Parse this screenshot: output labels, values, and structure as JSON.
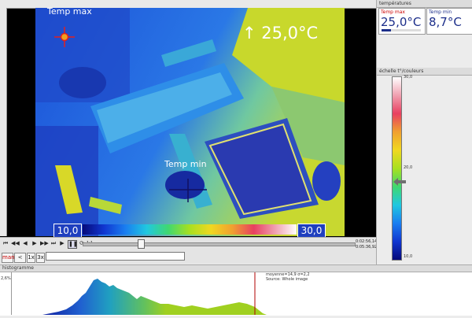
{
  "overlay": {
    "temp_max_label": "Temp max",
    "temp_min_label": "Temp min",
    "spot_reading": "↑ 25,0°C"
  },
  "scale": {
    "min_label": "10,0",
    "max_label": "30,0",
    "vertical_top": "30,0",
    "vertical_mid": "20,0",
    "vertical_bottom": "10,0"
  },
  "transport": {
    "speed_value": "1:1",
    "time_current": "0:02:56,14",
    "time_total": "0:05:36,92",
    "btn_man": "man",
    "btn_range": "< >",
    "btn_1x": "1x",
    "btn_3x": "3x"
  },
  "temps_panel": {
    "title": "températures",
    "max_label": "Temp max",
    "max_value": "25,0°C",
    "min_label": "Temp min",
    "min_value": "8,7°C"
  },
  "scale_panel": {
    "title": "échelle t°/couleurs"
  },
  "histogram": {
    "title": "histogramme",
    "y_label": "2,6%",
    "stats": "moyenne=14,9 σ=2,2",
    "source": "Source: Whole image"
  },
  "colors": {
    "overlay_text": "#ffffff",
    "value_blue": "#1c2e8a",
    "label_red": "#cc0000",
    "hist_marker": "#b00000"
  }
}
